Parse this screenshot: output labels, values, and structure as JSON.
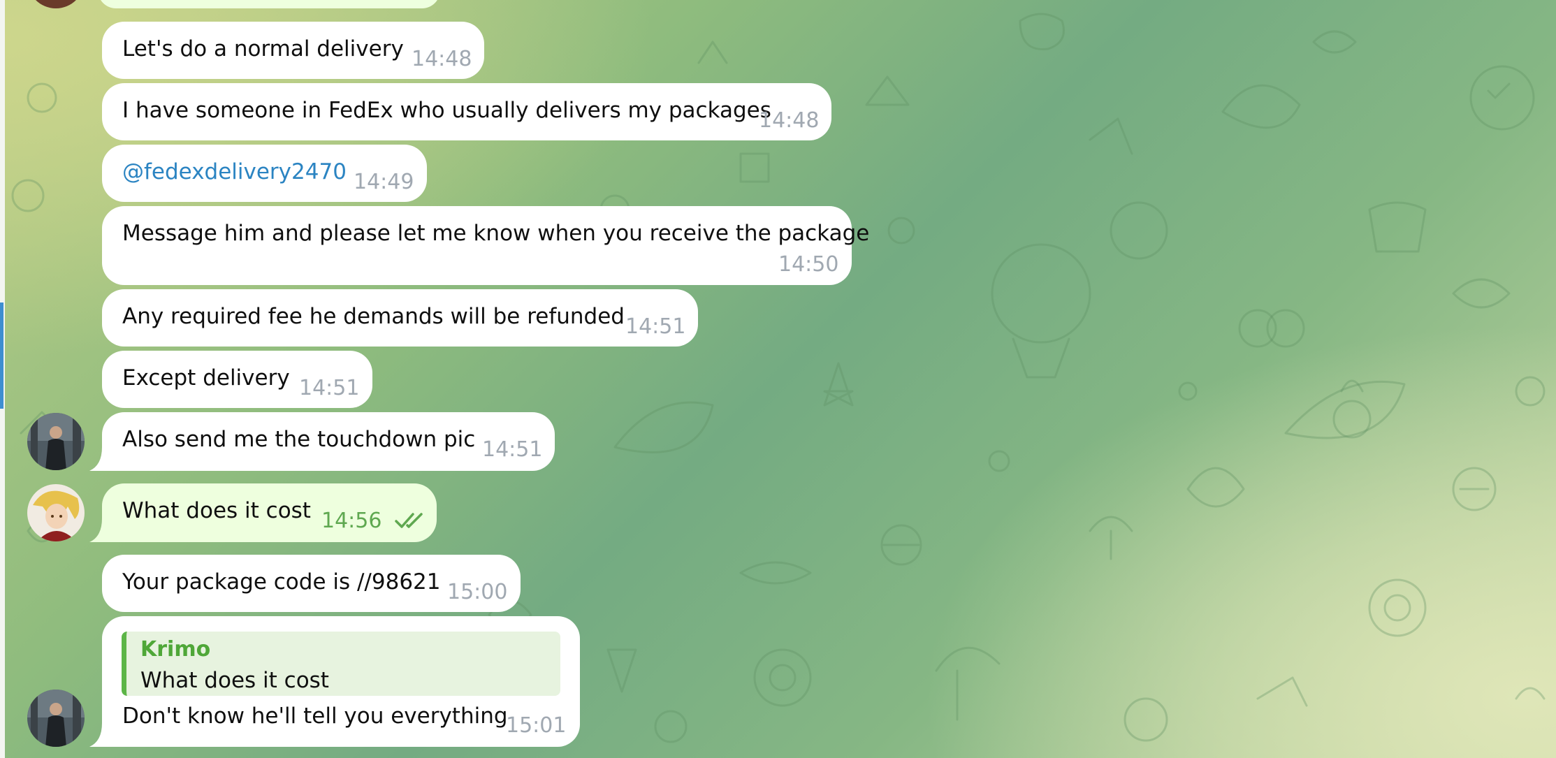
{
  "messages": [
    {
      "text": "Let's do a normal delivery",
      "time": "14:48"
    },
    {
      "text": "I have someone in FedEx who usually delivers my packages",
      "time": "14:48"
    },
    {
      "text": "@fedexdelivery2470",
      "time": "14:49"
    },
    {
      "text": "Message him and please let me know when you receive the package",
      "time": "14:50"
    },
    {
      "text": "Any required fee he demands will be refunded",
      "time": "14:51"
    },
    {
      "text": "Except delivery",
      "time": "14:51"
    },
    {
      "text": "Also send me the touchdown pic",
      "time": "14:51"
    },
    {
      "text": "What does it cost",
      "time": "14:56",
      "status": "read"
    },
    {
      "text": "Your package code is //98621",
      "time": "15:00"
    },
    {
      "text": "Don't know he'll tell you everything",
      "time": "15:01",
      "reply_to": {
        "name": "Krimo",
        "text": "What does it cost"
      }
    }
  ],
  "colors": {
    "incoming_bubble": "#ffffff",
    "outgoing_bubble": "#eeffde",
    "link": "#2b84c2",
    "reply_accent": "#5cb547",
    "time_incoming": "#a0a8b1",
    "time_outgoing": "#5fa850",
    "sidebar_accent": "#3e8ed0"
  }
}
